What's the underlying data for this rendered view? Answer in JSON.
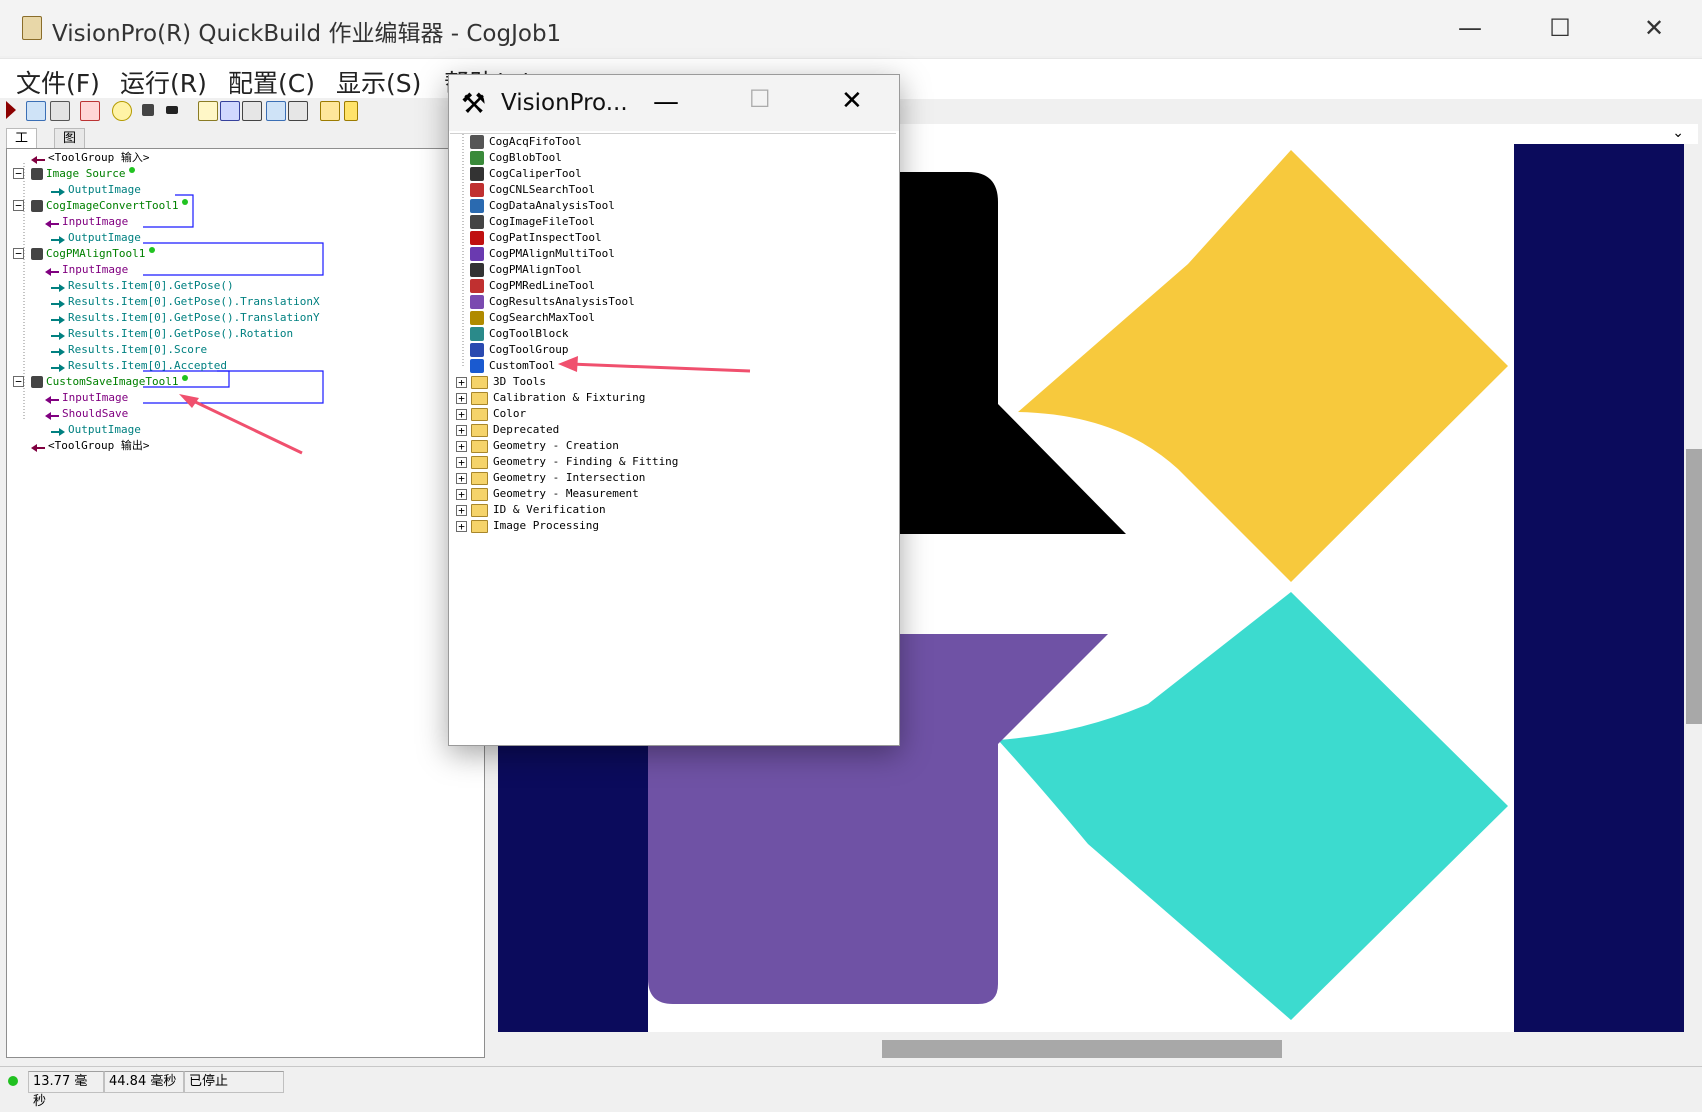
{
  "window": {
    "title": "VisionPro(R) QuickBuild 作业编辑器 - CogJob1",
    "minimize_glyph": "—",
    "maximize_glyph": "☐",
    "close_glyph": "✕"
  },
  "menu": [
    "文件(F)",
    "运行(R)",
    "配置(C)",
    "显示(S)",
    "帮助(H)"
  ],
  "tabs": [
    "工具",
    "图形"
  ],
  "tree": [
    {
      "label": "<ToolGroup 输入>",
      "indent": 0,
      "kind": "group",
      "color": "#000000"
    },
    {
      "label": "Image Source",
      "indent": 0,
      "kind": "tool",
      "color": "#008000",
      "expander": "−",
      "dot": true
    },
    {
      "label": "OutputImage",
      "indent": 2,
      "kind": "out",
      "color": "#008080"
    },
    {
      "label": "CogImageConvertTool1",
      "indent": 0,
      "kind": "tool",
      "color": "#008000",
      "expander": "−",
      "dot": true
    },
    {
      "label": "InputImage",
      "indent": 1,
      "kind": "in",
      "color": "#800080"
    },
    {
      "label": "OutputImage",
      "indent": 2,
      "kind": "out",
      "color": "#008080"
    },
    {
      "label": "CogPMAlignTool1",
      "indent": 0,
      "kind": "tool",
      "color": "#008000",
      "expander": "−",
      "dot": true
    },
    {
      "label": "InputImage",
      "indent": 1,
      "kind": "in",
      "color": "#800080"
    },
    {
      "label": "Results.Item[0].GetPose()",
      "indent": 2,
      "kind": "out",
      "color": "#008080"
    },
    {
      "label": "Results.Item[0].GetPose().TranslationX",
      "indent": 2,
      "kind": "out",
      "color": "#008080"
    },
    {
      "label": "Results.Item[0].GetPose().TranslationY",
      "indent": 2,
      "kind": "out",
      "color": "#008080"
    },
    {
      "label": "Results.Item[0].GetPose().Rotation",
      "indent": 2,
      "kind": "out",
      "color": "#008080"
    },
    {
      "label": "Results.Item[0].Score",
      "indent": 2,
      "kind": "out",
      "color": "#008080"
    },
    {
      "label": "Results.Item[0].Accepted",
      "indent": 2,
      "kind": "out",
      "color": "#008080"
    },
    {
      "label": "CustomSaveImageTool1",
      "indent": 0,
      "kind": "tool",
      "color": "#008000",
      "expander": "−",
      "dot": true
    },
    {
      "label": "InputImage",
      "indent": 1,
      "kind": "in",
      "color": "#800080"
    },
    {
      "label": "ShouldSave",
      "indent": 1,
      "kind": "in",
      "color": "#800080"
    },
    {
      "label": "OutputImage",
      "indent": 2,
      "kind": "out",
      "color": "#008080"
    },
    {
      "label": "<ToolGroup 输出>",
      "indent": 0,
      "kind": "group",
      "color": "#000000"
    }
  ],
  "popup": {
    "title": "VisionPro...",
    "tools": [
      "CogAcqFifoTool",
      "CogBlobTool",
      "CogCaliperTool",
      "CogCNLSearchTool",
      "CogDataAnalysisTool",
      "CogImageFileTool",
      "CogPatInspectTool",
      "CogPMAlignMultiTool",
      "CogPMAlignTool",
      "CogPMRedLineTool",
      "CogResultsAnalysisTool",
      "CogSearchMaxTool",
      "CogToolBlock",
      "CogToolGroup",
      "CustomTool"
    ],
    "folders": [
      "3D Tools",
      "Calibration & Fixturing",
      "Color",
      "Deprecated",
      "Geometry - Creation",
      "Geometry - Finding & Fitting",
      "Geometry - Intersection",
      "Geometry - Measurement",
      "ID & Verification",
      "Image Processing"
    ],
    "expander_glyph": "+"
  },
  "status": {
    "time1": "13.77 毫秒",
    "time2": "44.84 毫秒",
    "state": "已停止"
  },
  "colors": {
    "navy": "#0b0b5c",
    "yellow": "#f7c93d",
    "teal": "#3cdbcf",
    "purple": "#6f52a5",
    "black": "#000000",
    "annotation": "#f0506e"
  }
}
